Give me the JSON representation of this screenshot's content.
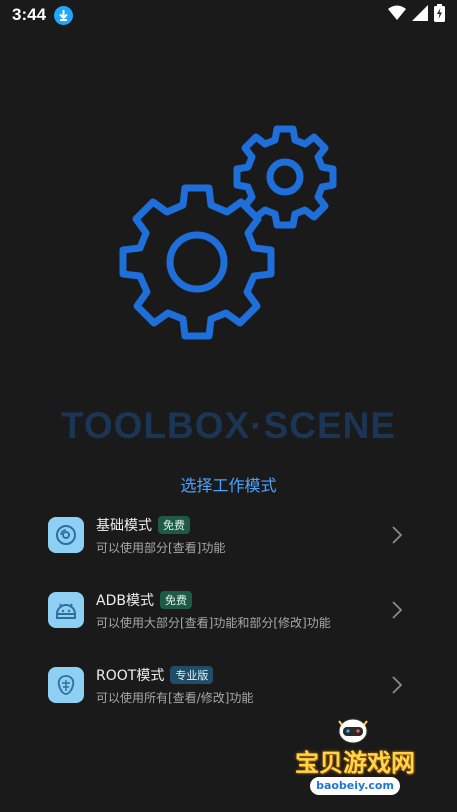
{
  "status_bar": {
    "time": "3:44",
    "icons": [
      "download-icon",
      "wifi-icon",
      "signal-icon",
      "battery-charging-icon"
    ]
  },
  "brand": {
    "title": "TOOLBOX·SCENE"
  },
  "subtitle": "选择工作模式",
  "modes": [
    {
      "title": "基础模式",
      "badge": "免费",
      "description": "可以使用部分[查看]功能",
      "icon": "disc-icon"
    },
    {
      "title": "ADB模式",
      "badge": "免费",
      "description": "可以使用大部分[查看]功能和部分[修改]功能",
      "icon": "android-icon"
    },
    {
      "title": "ROOT模式",
      "badge": "专业版",
      "description": "可以使用所有[查看/修改]功能",
      "icon": "chip-icon"
    }
  ],
  "watermark": {
    "title": "宝贝游戏网",
    "domain": "baobeiy.com"
  },
  "colors": {
    "background": "#1a1a1a",
    "gear": "#1e6fd9",
    "accent": "#4aa3ff",
    "brand_text": "#1b3555",
    "icon_bg": "#8ed0f3",
    "badge_free": "#1f5a47",
    "badge_pro": "#1f4e66"
  }
}
